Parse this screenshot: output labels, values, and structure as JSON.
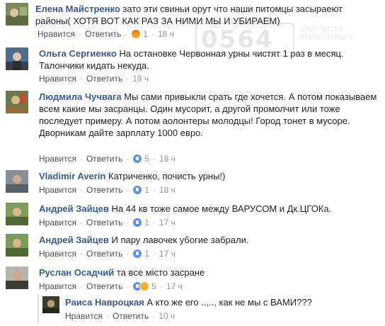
{
  "colors": {
    "author": "#385898",
    "text": "#1d2129",
    "meta": "#90949c",
    "like": "#5890ff"
  },
  "actions": {
    "like": "Нравится",
    "reply": "Ответить",
    "sep": "·"
  },
  "watermark": {
    "number": "0564",
    "line1": "САЙТ МІСТА",
    "line2": "КРИВОГО РОГУ"
  },
  "comments": [
    {
      "author": "Елена Майстренко",
      "text": "зато эти свиньи орут что наши питомцы засыраеют районы( ХОТЯ ВОТ КАК РАЗ ЗА НИМИ МЫ И УБИРАЕМ)",
      "reactions": "1",
      "reaction_icon": "angry-icon",
      "time": "18 ч"
    },
    {
      "author": "Ольга Сергиенко",
      "text": "На остановке Червонная урны чистят 1 раз в месяц. Талончики кидать некуда.",
      "reactions": "",
      "reaction_icon": "",
      "time": "18 ч"
    },
    {
      "author": "Людмила Чучвага",
      "text": "Мы сами привыкли срать где хочется. А потом показываем всем какие мы засранцы. Один мусорит, а другой промолчит или тоже последует примеру. А потом аолонтеры молодцы! Город тонет в мусоре.\nДворникам дайте зарплату 1000 евро.",
      "reactions": "5",
      "reaction_icon": "like-icon",
      "time": "18 ч"
    },
    {
      "author": "Vladimir Averin",
      "text": "Катриченко, почисть урны!)",
      "reactions": "1",
      "reaction_icon": "like-icon",
      "time": "18 ч"
    },
    {
      "author": "Андрей Зайцев",
      "text": "На 44 кв тоже самое между ВАРУСОМ и Дк.ЦГОКа.",
      "reactions": "1",
      "reaction_icon": "like-icon",
      "time": "17 ч"
    },
    {
      "author": "Андрей Зайцев",
      "text": "И пару лавочек убогие забрали.",
      "reactions": "1",
      "reaction_icon": "like-icon",
      "time": "17 ч"
    },
    {
      "author": "Руслан Осадчий",
      "text": "та все місто засране",
      "reactions": "5",
      "reaction_icon": "like-sad-icon",
      "time": "17 ч"
    },
    {
      "author": "Раиса Навроцкая",
      "text": "А кто же его ..,.., как не мы с ВАМИ???",
      "reactions": "",
      "reaction_icon": "",
      "time": "10 ч"
    }
  ]
}
